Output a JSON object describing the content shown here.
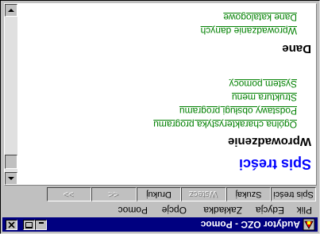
{
  "window": {
    "title": "Audytor OZC - Pomoc"
  },
  "menubar": {
    "items": [
      "Plik",
      "Edycja",
      "Zakładka",
      "Opcje",
      "Pomoc"
    ]
  },
  "toolbar": {
    "buttons": [
      {
        "label": "Spis treści",
        "enabled": true
      },
      {
        "label": "Szukaj",
        "enabled": true
      },
      {
        "label": "Wstecz",
        "enabled": false
      },
      {
        "label": "Drukuj",
        "enabled": true
      },
      {
        "label": "<<",
        "enabled": false
      },
      {
        "label": ">>",
        "enabled": false
      }
    ]
  },
  "content": {
    "title": "Spis treści",
    "section1": {
      "heading": "Wprowadzenie",
      "links": [
        "Ogólna charakterystyka programu",
        "Podstawy obsługi programu",
        "Struktura menu",
        "System pomocy"
      ]
    },
    "section2": {
      "heading": "Dane",
      "links": [
        "Wprowadzanie danych",
        "Dane katalogowe"
      ]
    }
  },
  "colors": {
    "titlebar": "#000080",
    "title_text": "#0000ff",
    "link": "#008000",
    "face": "#c0c0c0"
  }
}
